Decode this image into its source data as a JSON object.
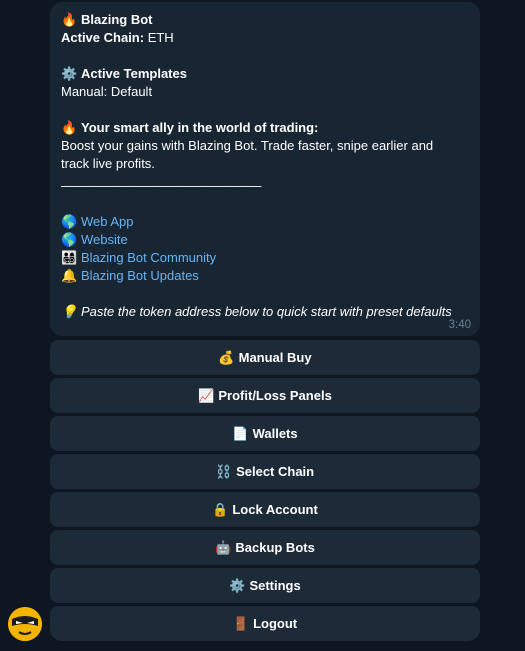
{
  "message": {
    "bot_name_emoji": "🔥",
    "bot_name": "Blazing Bot",
    "active_chain_label": "Active Chain:",
    "active_chain_value": " ETH",
    "templates_emoji": "⚙️",
    "templates_heading": "Active Templates",
    "templates_value": "Manual: Default",
    "ally_emoji": "🔥",
    "ally_heading": "Your smart ally in the world of trading:",
    "description": "Boost your gains with Blazing Bot. Trade faster, snipe earlier and track live profits.",
    "separator": "————————————————",
    "links": [
      {
        "emoji": "🌎",
        "label": "Web App"
      },
      {
        "emoji": "🌎",
        "label": "Website"
      },
      {
        "emoji": "👨‍👩‍👧‍👦",
        "label": "Blazing Bot Community"
      },
      {
        "emoji": "🔔",
        "label": "Blazing Bot Updates"
      }
    ],
    "tip_emoji": "💡",
    "tip": "Paste the token address below to quick start with preset defaults",
    "time": "3:40"
  },
  "keyboard": [
    {
      "emoji": "💰",
      "label": "Manual Buy"
    },
    {
      "emoji": "📈",
      "label": "Profit/Loss Panels"
    },
    {
      "emoji": "📄",
      "label": "Wallets"
    },
    {
      "emoji": "⛓️",
      "label": "Select Chain"
    },
    {
      "emoji": "🔒",
      "label": "Lock Account"
    },
    {
      "emoji": "🤖",
      "label": "Backup Bots"
    },
    {
      "emoji": "⚙️",
      "label": "Settings"
    },
    {
      "emoji": "🚪",
      "label": "Logout"
    }
  ],
  "avatar_color": "#f5b400"
}
